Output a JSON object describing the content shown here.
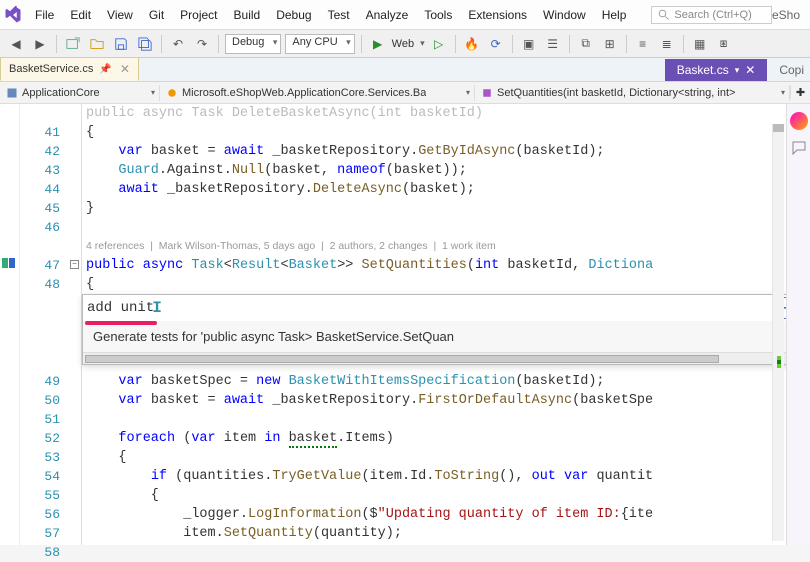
{
  "menu": [
    "File",
    "Edit",
    "View",
    "Git",
    "Project",
    "Build",
    "Debug",
    "Test",
    "Analyze",
    "Tools",
    "Extensions",
    "Window",
    "Help"
  ],
  "search_placeholder": "Search (Ctrl+Q)",
  "title_right": "eSho",
  "toolbar": {
    "config": "Debug",
    "platform": "Any CPU",
    "start": "Web"
  },
  "tabs": {
    "active": "BasketService.cs",
    "right_tab": "Basket.cs",
    "copilot_label": "Copi"
  },
  "nav": {
    "project": "ApplicationCore",
    "type": "Microsoft.eShopWeb.ApplicationCore.Services.Ba",
    "member": "SetQuantities(int basketId, Dictionary<string, int>"
  },
  "codelens": "4 references | Mark Wilson-Thomas, 5 days ago | 2 authors, 2 changes | 1 work item",
  "copilot": {
    "input": "add unit",
    "suggestion": "Generate tests for 'public async Task<Result<Basket>> BasketService.SetQuan"
  },
  "lines": [
    {
      "n": "",
      "txt": "public async Task DeleteBasketAsync(int basketId)",
      "dim": true
    },
    {
      "n": "41",
      "txt": "{"
    },
    {
      "n": "42",
      "txt": "    var basket = await _basketRepository.GetByIdAsync(basketId);",
      "tokens": [
        [
          "kw",
          "var"
        ],
        [
          "",
          " basket "
        ],
        [
          "",
          "= "
        ],
        [
          "kw",
          "await"
        ],
        [
          "",
          " _basketRepository."
        ],
        [
          "mtd",
          "GetByIdAsync"
        ],
        [
          "",
          "(basketId);"
        ]
      ]
    },
    {
      "n": "43",
      "txt": "    Guard.Against.Null(basket, nameof(basket));",
      "tokens": [
        [
          "tp",
          "Guard"
        ],
        [
          "",
          "."
        ],
        [
          "",
          "Against"
        ],
        [
          "",
          "."
        ],
        [
          "mtd",
          "Null"
        ],
        [
          "",
          "(basket, "
        ],
        [
          "kw",
          "nameof"
        ],
        [
          "",
          "(basket));"
        ]
      ]
    },
    {
      "n": "44",
      "txt": "    await _basketRepository.DeleteAsync(basket);",
      "tokens": [
        [
          "kw",
          "await"
        ],
        [
          "",
          " _basketRepository."
        ],
        [
          "mtd",
          "DeleteAsync"
        ],
        [
          "",
          "(basket);"
        ]
      ]
    },
    {
      "n": "45",
      "txt": "}"
    },
    {
      "n": "46",
      "txt": ""
    },
    {
      "n": "",
      "txt": "CODELENS"
    },
    {
      "n": "47",
      "txt": "public async Task<Result<Basket>> SetQuantities(int basketId, Dictiona",
      "tokens": [
        [
          "kw",
          "public"
        ],
        [
          "",
          " "
        ],
        [
          "kw",
          "async"
        ],
        [
          "",
          " "
        ],
        [
          "tp",
          "Task"
        ],
        [
          "",
          "<"
        ],
        [
          "tp",
          "Result"
        ],
        [
          "",
          "<"
        ],
        [
          "tp",
          "Basket"
        ],
        [
          "",
          ">> "
        ],
        [
          "mtd",
          "SetQuantities"
        ],
        [
          "",
          "("
        ],
        [
          "kw",
          "int"
        ],
        [
          "",
          " basketId, "
        ],
        [
          "tp",
          "Dictiona"
        ]
      ]
    },
    {
      "n": "48",
      "txt": "{"
    },
    {
      "n": "POPUP",
      "txt": ""
    },
    {
      "n": "49",
      "txt": "    var basketSpec = new BasketWithItemsSpecification(basketId);",
      "tokens": [
        [
          "kw",
          "var"
        ],
        [
          "",
          " basketSpec = "
        ],
        [
          "kw",
          "new"
        ],
        [
          "",
          " "
        ],
        [
          "tp",
          "BasketWithItemsSpecification"
        ],
        [
          "",
          "(basketId);"
        ]
      ]
    },
    {
      "n": "50",
      "txt": "    var basket = await _basketRepository.FirstOrDefaultAsync(basketSpe",
      "tokens": [
        [
          "kw",
          "var"
        ],
        [
          "",
          " basket = "
        ],
        [
          "kw",
          "await"
        ],
        [
          "",
          " _basketRepository."
        ],
        [
          "mtd",
          "FirstOrDefaultAsync"
        ],
        [
          "",
          "(basketSpe"
        ]
      ]
    },
    {
      "n": "51",
      "txt": ""
    },
    {
      "n": "52",
      "txt": "    foreach (var item in basket.Items)",
      "tokens": [
        [
          "kw",
          "foreach"
        ],
        [
          "",
          " ("
        ],
        [
          "kw",
          "var"
        ],
        [
          "",
          " item "
        ],
        [
          "kw",
          "in"
        ],
        [
          "",
          " "
        ],
        [
          "sq",
          "basket"
        ],
        [
          "",
          ".Items)"
        ]
      ]
    },
    {
      "n": "53",
      "txt": "    {"
    },
    {
      "n": "54",
      "txt": "        if (quantities.TryGetValue(item.Id.ToString(), out var quantit",
      "tokens": [
        [
          "kw",
          "if"
        ],
        [
          "",
          " (quantities."
        ],
        [
          "mtd",
          "TryGetValue"
        ],
        [
          "",
          "(item.Id."
        ],
        [
          "mtd",
          "ToString"
        ],
        [
          "",
          "(), "
        ],
        [
          "kw",
          "out"
        ],
        [
          "",
          " "
        ],
        [
          "kw",
          "var"
        ],
        [
          "",
          " quantit"
        ]
      ]
    },
    {
      "n": "55",
      "txt": "        {"
    },
    {
      "n": "56",
      "txt": "            _logger.LogInformation($\"Updating quantity of item ID:{ite",
      "tokens": [
        [
          "",
          "_logger."
        ],
        [
          "mtd",
          "LogInformation"
        ],
        [
          "",
          "($"
        ],
        [
          "str",
          "\"Updating quantity of item ID:"
        ],
        [
          "",
          "{ite"
        ]
      ]
    },
    {
      "n": "57",
      "txt": "            item.SetQuantity(quantity);",
      "tokens": [
        [
          "",
          "item."
        ],
        [
          "mtd",
          "SetQuantity"
        ],
        [
          "",
          "(quantity);"
        ]
      ]
    },
    {
      "n": "58",
      "txt": "            }",
      "tail": true
    }
  ]
}
